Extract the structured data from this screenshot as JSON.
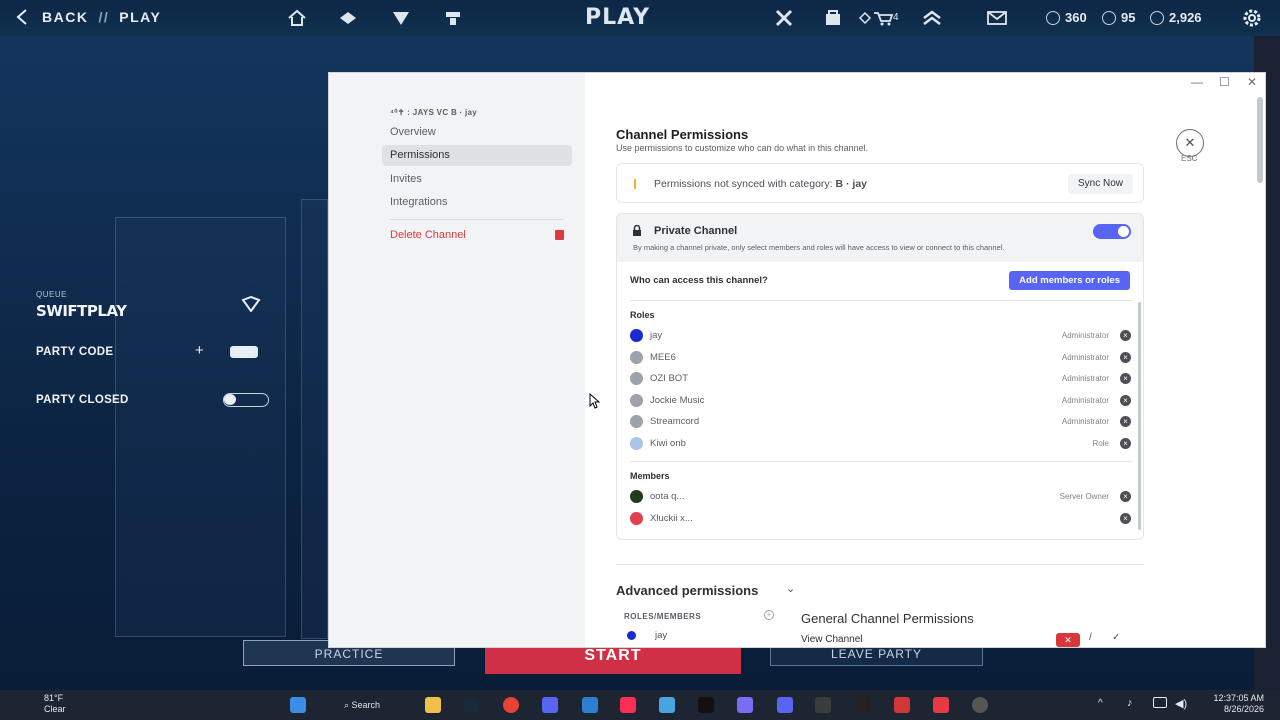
{
  "game": {
    "back_label": "BACK",
    "slash": "//",
    "section": "PLAY",
    "title": "PLAY",
    "badge_count": "4",
    "currency": [
      {
        "icon": "valorant-points-icon",
        "value": "360"
      },
      {
        "icon": "radianite-icon",
        "value": "95"
      },
      {
        "icon": "kingdom-credits-icon",
        "value": "2,926"
      }
    ],
    "queue_label": "QUEUE",
    "queue_mode": "SWIFTPLAY",
    "party_code_label": "PARTY CODE",
    "party_closed_label": "PARTY CLOSED",
    "buttons": {
      "practice": "PRACTICE",
      "start": "START",
      "leave_party": "LEAVE PARTY"
    }
  },
  "discord": {
    "server_name": "JAYS VC",
    "server_prefix": "⁴⁰✝ :",
    "server_suffix": "B · jay",
    "sidebar": [
      {
        "label": "Overview"
      },
      {
        "label": "Permissions"
      },
      {
        "label": "Invites"
      },
      {
        "label": "Integrations"
      }
    ],
    "delete_channel": "Delete Channel",
    "heading": "Channel Permissions",
    "subheading": "Use permissions to customize who can do what in this channel.",
    "sync": {
      "text": "Permissions not synced with category:",
      "category": "B · jay",
      "button": "Sync Now"
    },
    "private": {
      "title": "Private Channel",
      "description": "By making a channel private, only select members and roles will have access to view or connect to this channel.",
      "enabled": true
    },
    "who_access": "Who can access this channel?",
    "add_button": "Add members or roles",
    "roles_label": "Roles",
    "roles": [
      {
        "name": "jay",
        "tag": "Administrator",
        "color": "#1a2bd1"
      },
      {
        "name": "MEE6",
        "tag": "Administrator",
        "color": "#9da2ab"
      },
      {
        "name": "OZI BOT",
        "tag": "Administrator",
        "color": "#9da2ab"
      },
      {
        "name": "Jockie Music",
        "tag": "Administrator",
        "color": "#9da2ab"
      },
      {
        "name": "Streamcord",
        "tag": "Administrator",
        "color": "#9da2ab"
      },
      {
        "name": "Kiwi onb",
        "tag": "Role",
        "color": "#a9c4e8"
      }
    ],
    "members_label": "Members",
    "members": [
      {
        "name": "oota q...",
        "tag": "Server Owner",
        "color": "#1f3d1a"
      },
      {
        "name": "Xluckii x...",
        "tag": "",
        "color": "#e04050"
      }
    ],
    "advanced_title": "Advanced permissions",
    "roles_members_label": "ROLES/MEMBERS",
    "rm_entry": "jay",
    "general_title": "General Channel Permissions",
    "view_channel": "View Channel",
    "esc": "ESC"
  },
  "taskbar": {
    "temp": "81°F",
    "condition": "Clear",
    "search": "Search",
    "time": "12:37:05 AM",
    "date": "8/26/2026"
  }
}
